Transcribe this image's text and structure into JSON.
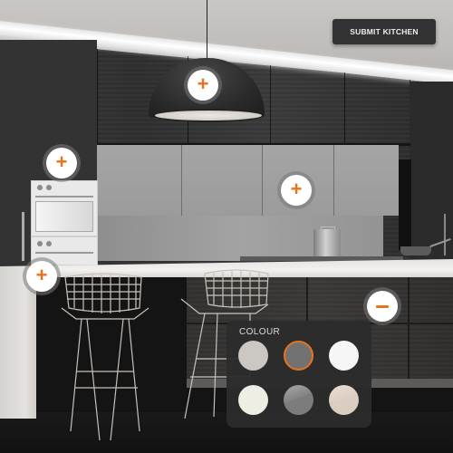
{
  "header": {
    "submit_label": "SUBMIT KITCHEN"
  },
  "hotspots": [
    {
      "id": "pendant-lamp",
      "type": "add",
      "glyph": "+"
    },
    {
      "id": "tall-units",
      "type": "add",
      "glyph": "+"
    },
    {
      "id": "wall-cabinets",
      "type": "add",
      "glyph": "+"
    },
    {
      "id": "worktop",
      "type": "add",
      "glyph": "+"
    },
    {
      "id": "island-cabinets",
      "type": "remove",
      "glyph": "−"
    }
  ],
  "colour_panel": {
    "title": "COLOUR",
    "selected_index": 1,
    "swatches": [
      {
        "name": "light-grey",
        "color": "#cbc8c3"
      },
      {
        "name": "mid-grey",
        "color": "#727272"
      },
      {
        "name": "white",
        "color": "#f6f6f6"
      },
      {
        "name": "cream",
        "color": "#efeee4"
      },
      {
        "name": "gloss-grey",
        "color": "#7c7c7c"
      },
      {
        "name": "gloss-cashmere",
        "color": "#dccdc1"
      }
    ]
  },
  "accent_color": "#e8731c"
}
